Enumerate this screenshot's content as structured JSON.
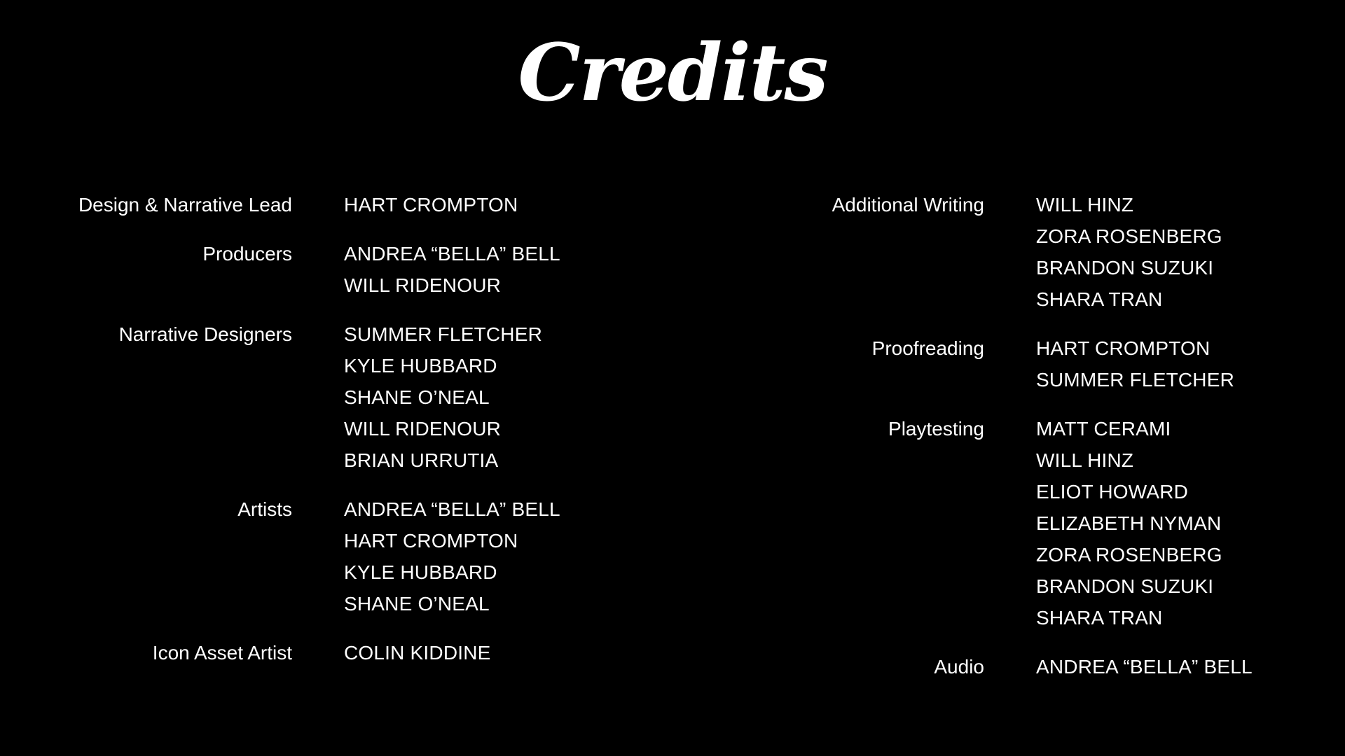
{
  "title": "Credits",
  "left_groups": [
    {
      "role": "Design & Narrative Lead",
      "names": [
        "HART CROMPTON"
      ]
    },
    {
      "role": "Producers",
      "names": [
        "ANDREA “BELLA” BELL",
        "WILL RIDENOUR"
      ]
    },
    {
      "role": "Narrative Designers",
      "names": [
        "SUMMER FLETCHER",
        "KYLE HUBBARD",
        "SHANE O’NEAL",
        "WILL RIDENOUR",
        "BRIAN URRUTIA"
      ]
    },
    {
      "role": "Artists",
      "names": [
        "ANDREA “BELLA” BELL",
        "HART CROMPTON",
        "KYLE HUBBARD",
        "SHANE O’NEAL"
      ]
    },
    {
      "role": "Icon Asset Artist",
      "names": [
        "COLIN KIDDINE"
      ]
    }
  ],
  "right_groups": [
    {
      "role": "Additional Writing",
      "names": [
        "WILL HINZ",
        "ZORA ROSENBERG",
        "BRANDON SUZUKI",
        "SHARA TRAN"
      ]
    },
    {
      "role": "Proofreading",
      "names": [
        "HART CROMPTON",
        "SUMMER FLETCHER"
      ]
    },
    {
      "role": "Playtesting",
      "names": [
        "MATT CERAMI",
        "WILL HINZ",
        "ELIOT HOWARD",
        "ELIZABETH NYMAN",
        "ZORA ROSENBERG",
        "BRANDON SUZUKI",
        "SHARA TRAN"
      ]
    },
    {
      "role": "Audio",
      "names": [
        "ANDREA “BELLA” BELL"
      ]
    }
  ]
}
